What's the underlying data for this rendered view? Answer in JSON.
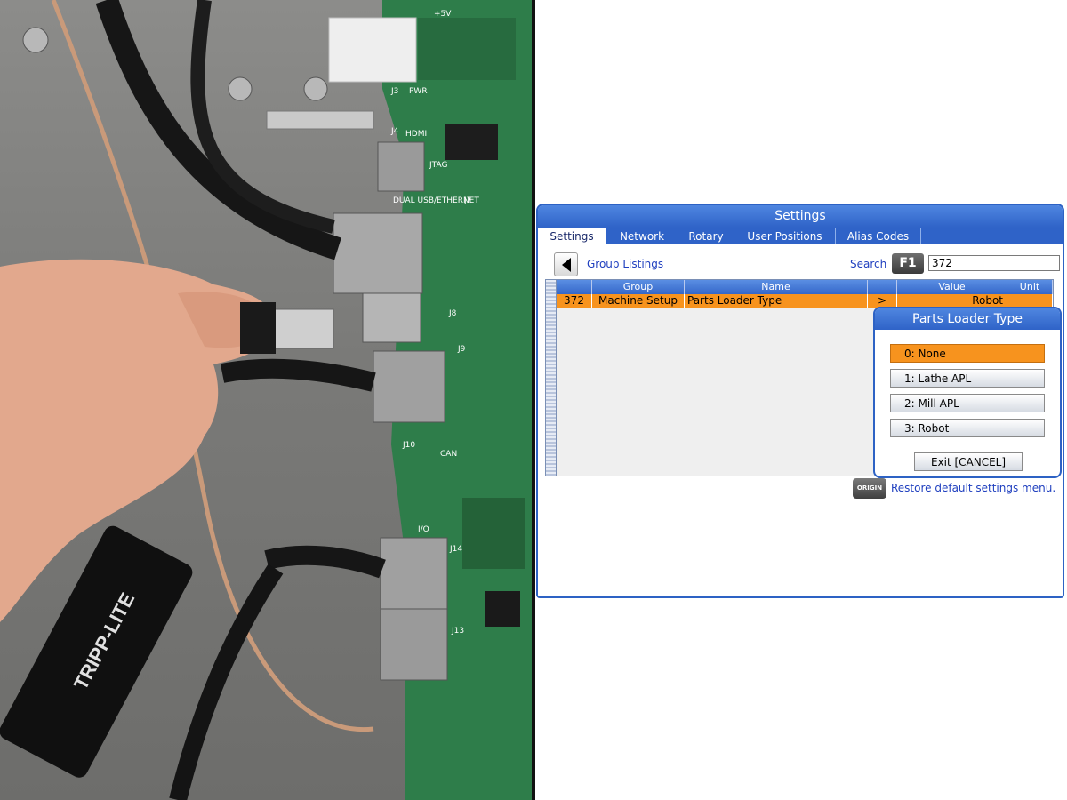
{
  "photo": {
    "board_labels": [
      "+5V",
      "J3",
      "PWR",
      "J4",
      "HDMI",
      "JTAG",
      "DUAL USB/ETHERNET",
      "J7",
      "J8",
      "J9",
      "J10",
      "CAN",
      "J14",
      "J13",
      "I/O"
    ],
    "adapter_brand": "TRIPP-LITE"
  },
  "screen": {
    "title": "Settings",
    "tabs": [
      {
        "label": "Settings",
        "active": true
      },
      {
        "label": "Network",
        "active": false
      },
      {
        "label": "Rotary",
        "active": false
      },
      {
        "label": "User Positions",
        "active": false
      },
      {
        "label": "Alias Codes",
        "active": false
      }
    ],
    "group_listings": "Group Listings",
    "search_label": "Search",
    "f1_key": "F1",
    "search_value": "372",
    "table": {
      "headers": {
        "group": "Group",
        "name": "Name",
        "arrow": "",
        "value": "Value",
        "unit": "Unit"
      },
      "row": {
        "number": "372",
        "group": "Machine Setup",
        "name": "Parts Loader Type",
        "arrow": ">",
        "value": "Robot",
        "unit": ""
      }
    },
    "origin_key": "ORIGIN",
    "restore_text": "Restore default settings menu."
  },
  "popup": {
    "title": "Parts Loader Type",
    "options": [
      "0: None",
      "1: Lathe APL",
      "2: Mill APL",
      "3: Robot"
    ],
    "selected_index": 0,
    "exit_label": "Exit [CANCEL]"
  },
  "colors": {
    "accent_blue": "#2f63c8",
    "selected_orange": "#f7931e",
    "link_blue": "#1f3fbf"
  }
}
